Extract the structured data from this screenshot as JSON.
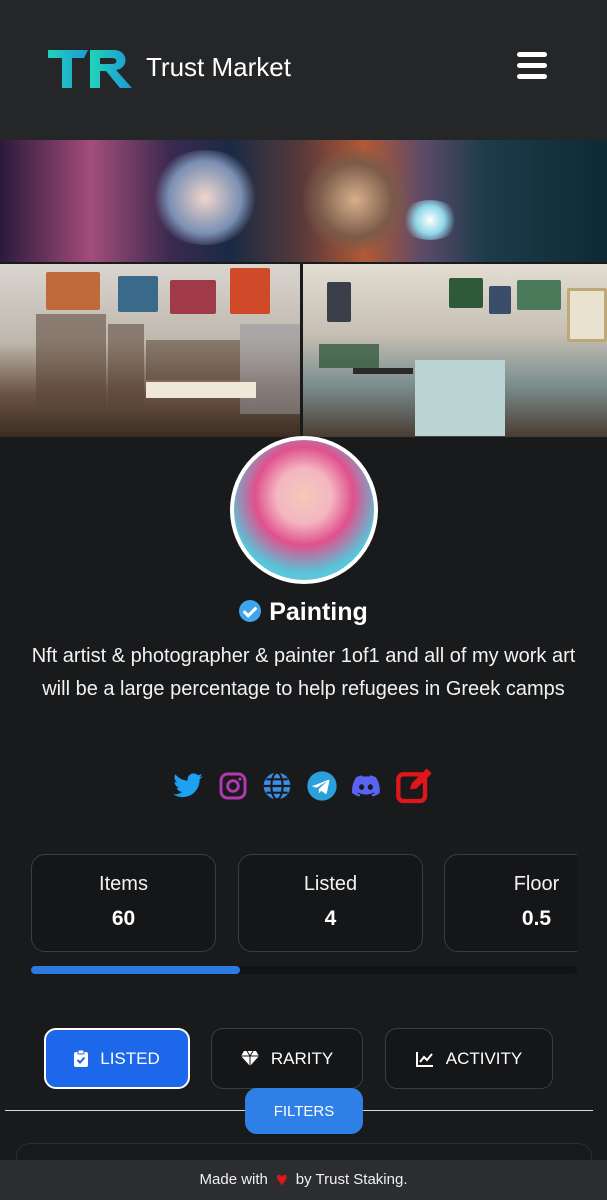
{
  "header": {
    "app_title": "Trust Market",
    "logo_text": "TR"
  },
  "profile": {
    "name": "Painting",
    "verified": true,
    "bio": "Nft artist & photographer & painter 1of1 and all of my work art will be a large percentage to help refugees in Greek camps"
  },
  "socials": [
    {
      "icon": "twitter-icon",
      "color": "#1da1f2"
    },
    {
      "icon": "instagram-icon",
      "color": "#b03ab0"
    },
    {
      "icon": "globe-icon",
      "color": "#3a8ee6"
    },
    {
      "icon": "telegram-icon",
      "color": "#2aa1da"
    },
    {
      "icon": "discord-icon",
      "color": "#5865f2"
    },
    {
      "icon": "edit-icon",
      "color": "#e0161b"
    }
  ],
  "stats": {
    "items_label": "Items",
    "items_value": "60",
    "listed_label": "Listed",
    "listed_value": "4",
    "floor_label": "Floor",
    "floor_value": "0.5"
  },
  "tabs": {
    "listed": "LISTED",
    "rarity": "RARITY",
    "activity": "ACTIVITY"
  },
  "filters_label": "FILTERS",
  "footer": {
    "prefix": "Made with",
    "suffix": "by Trust Staking."
  },
  "colors": {
    "accent": "#1c67ea",
    "filters": "#2f80e6",
    "logo": "#1fc8c0"
  }
}
